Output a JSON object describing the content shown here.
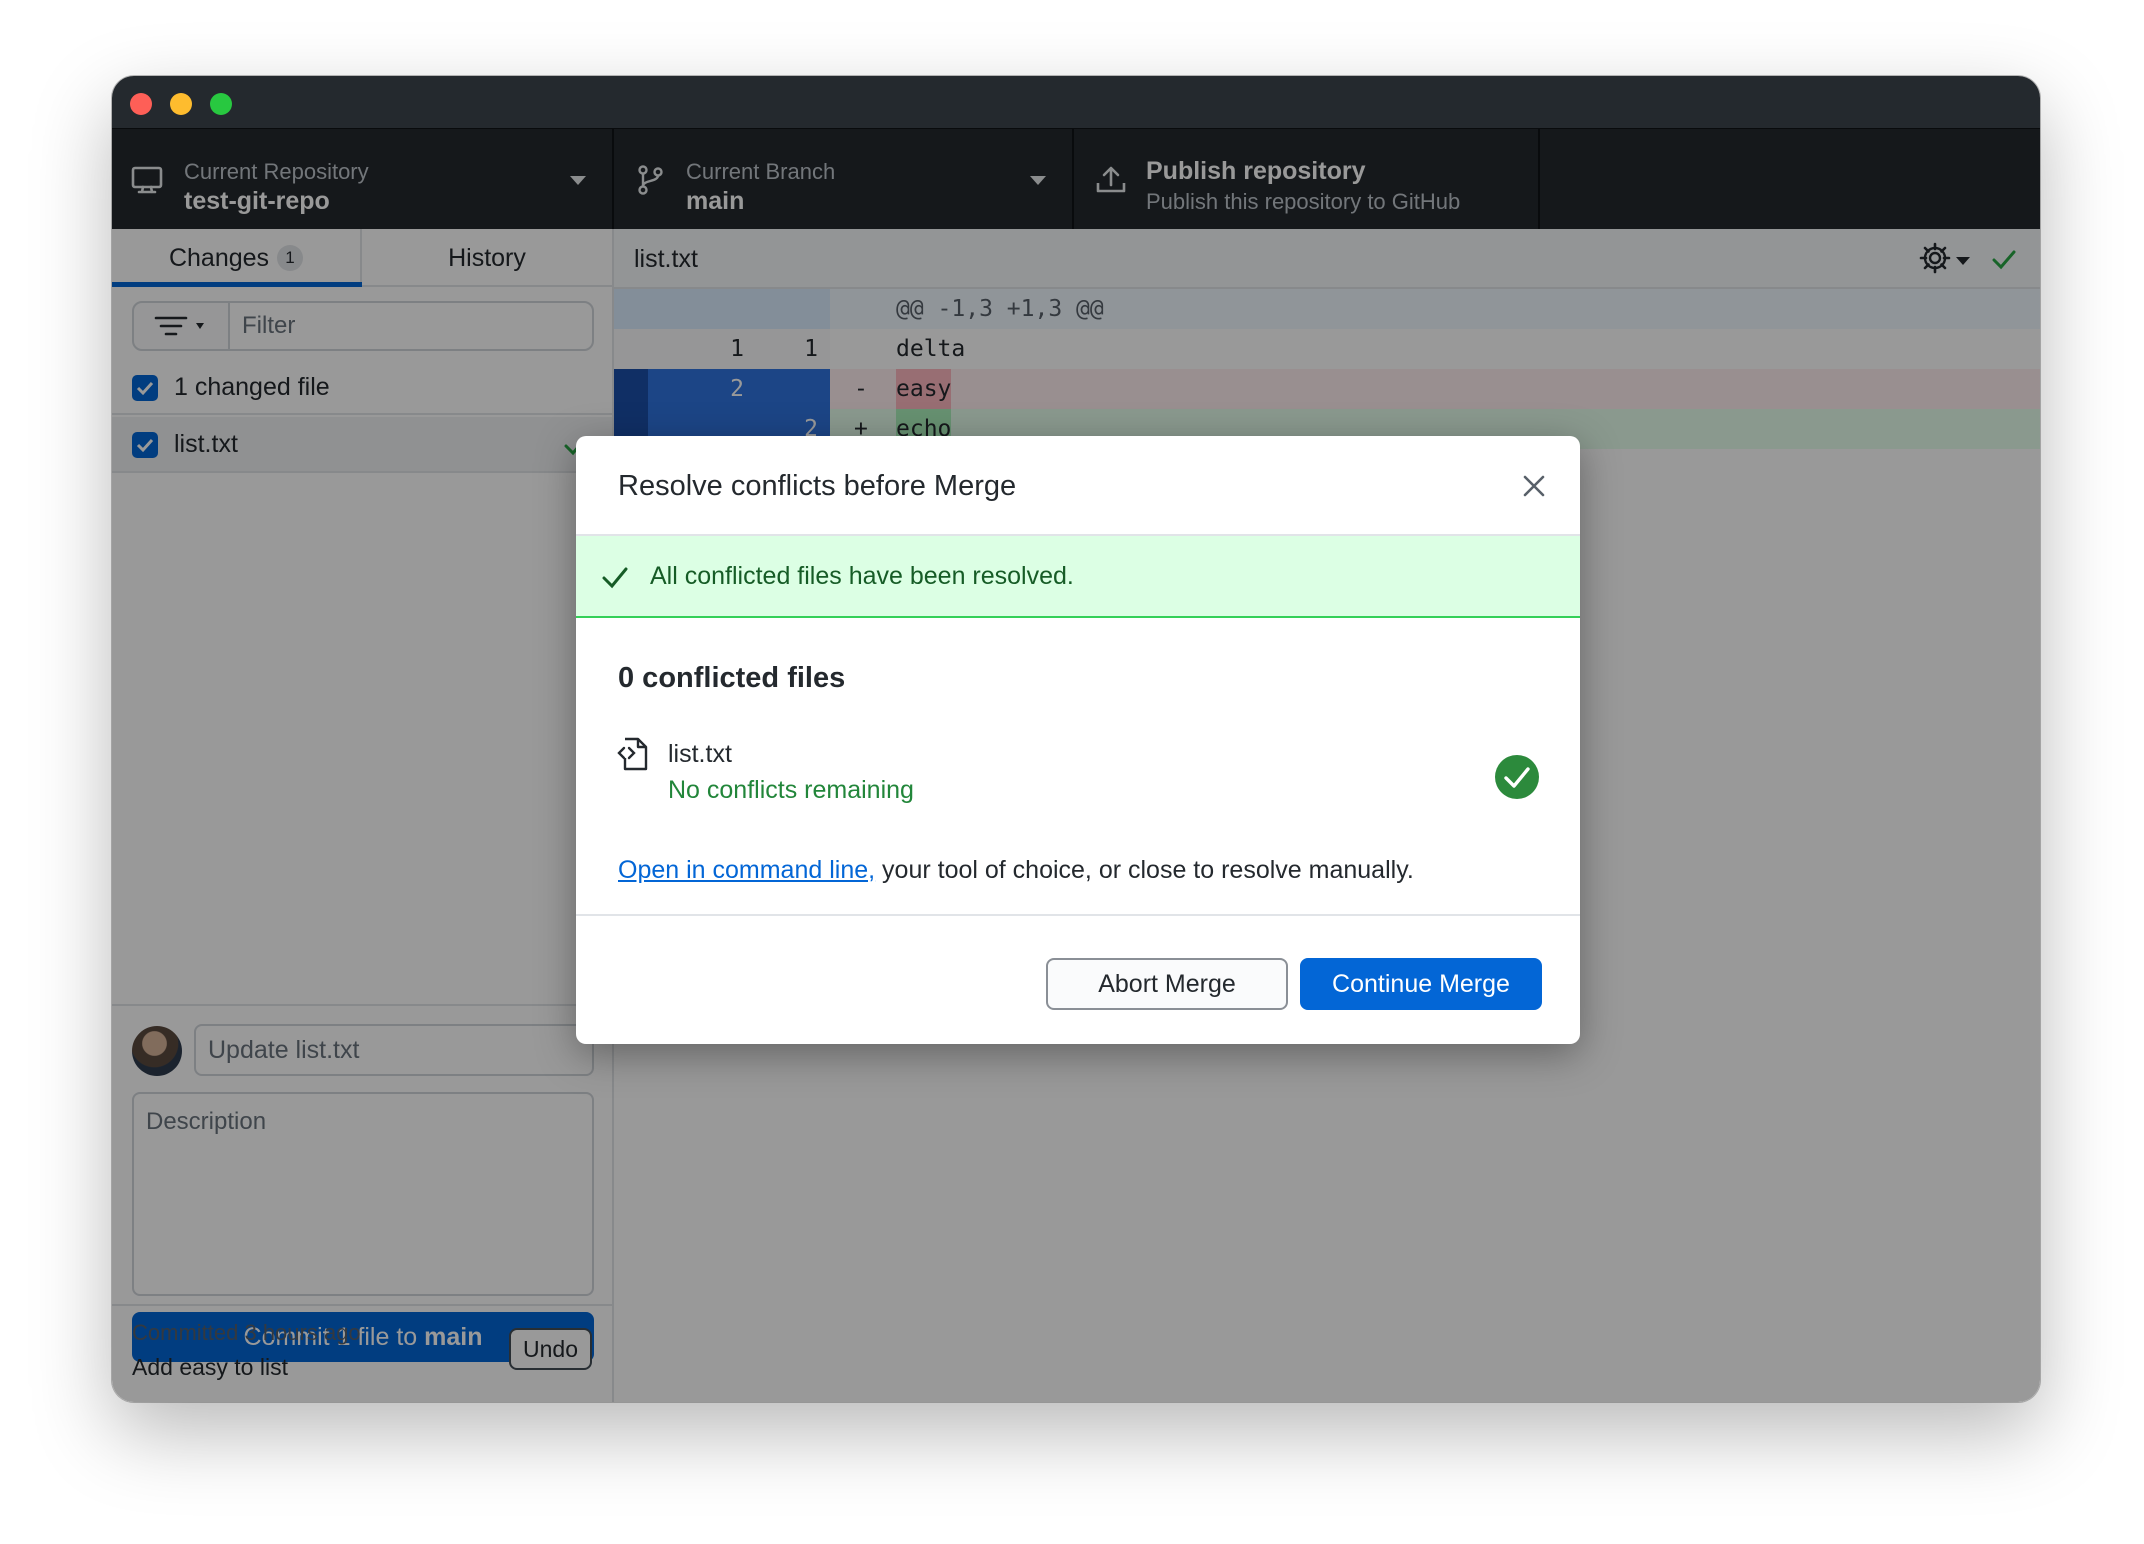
{
  "toolbar": {
    "repo_label": "Current Repository",
    "repo_value": "test-git-repo",
    "branch_label": "Current Branch",
    "branch_value": "main",
    "publish_label": "Publish repository",
    "publish_sub": "Publish this repository to GitHub"
  },
  "sidebar": {
    "tab_changes": "Changes",
    "tab_changes_count": "1",
    "tab_history": "History",
    "filter_placeholder": "Filter",
    "changed_files_label": "1 changed file",
    "files": [
      {
        "name": "list.txt"
      }
    ],
    "summary_placeholder": "Update list.txt",
    "description_placeholder": "Description",
    "commit_prefix": "Commit 1 file to ",
    "commit_branch": "main",
    "last_commit_time": "Committed 3 hours ago",
    "last_commit_message": "Add easy to list",
    "undo_label": "Undo"
  },
  "diff": {
    "file": "list.txt",
    "hunk": "@@ -1,3 +1,3 @@",
    "lines": [
      {
        "old": "1",
        "new": "1",
        "sign": "",
        "code": "delta"
      },
      {
        "old": "2",
        "new": "",
        "sign": "-",
        "code": "easy"
      },
      {
        "old": "",
        "new": "2",
        "sign": "+",
        "code": "echo"
      }
    ]
  },
  "modal": {
    "title": "Resolve conflicts before Merge",
    "banner": "All conflicted files have been resolved.",
    "count": "0 conflicted files",
    "file_name": "list.txt",
    "file_status": "No conflicts remaining",
    "hint_link": "Open in command line,",
    "hint_rest": " your tool of choice, or close to resolve manually.",
    "abort_label": "Abort Merge",
    "continue_label": "Continue Merge"
  },
  "colors": {
    "accent": "#0366d6",
    "toolbar_bg": "#24292e",
    "success": "#22863a",
    "banner_bg": "#dcffe4"
  }
}
